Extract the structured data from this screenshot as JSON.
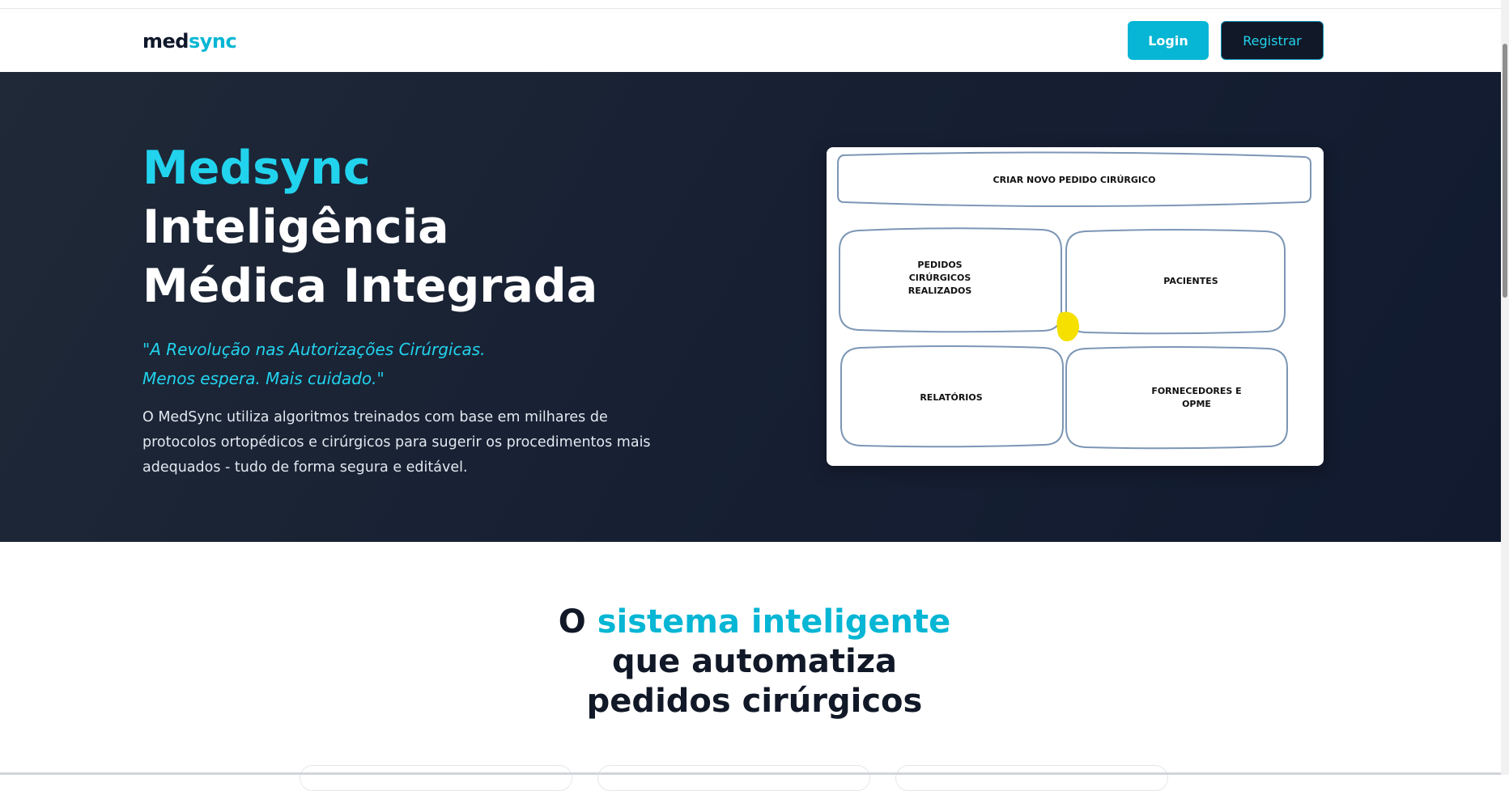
{
  "brand": {
    "part1": "med",
    "part2": "sync"
  },
  "nav": {
    "login_label": "Login",
    "register_label": "Registrar"
  },
  "hero": {
    "title_accent": "Medsync",
    "title_line2": "Inteligência",
    "title_line3": "Médica Integrada",
    "quote_line1": "\"A Revolução nas Autorizações Cirúrgicas.",
    "quote_line2": "Menos espera. Mais cuidado.\"",
    "description": "O MedSync utiliza algoritmos treinados com base em milhares de protocolos ortopédicos e cirúrgicos para sugerir os procedimentos mais adequados - tudo de forma segura e editável."
  },
  "preview": {
    "create_button": "CRIAR NOVO PEDIDO CIRÚRGICO",
    "tile_requests": [
      "PEDIDOS",
      "CIRÚRGICOS",
      "REALIZADOS"
    ],
    "tile_patients": "PACIENTES",
    "tile_reports": "RELATÓRIOS",
    "tile_suppliers": [
      "FORNECEDORES E",
      "OPME"
    ],
    "highlight_color": "#f5e000"
  },
  "section2": {
    "title_prefix": "O ",
    "title_highlight": "sistema inteligente",
    "title_line2": "que automatiza",
    "title_line3": "pedidos cirúrgicos"
  },
  "colors": {
    "accent": "#06b6d4",
    "dark": "#111827",
    "hero_bg": "#1b2436"
  }
}
